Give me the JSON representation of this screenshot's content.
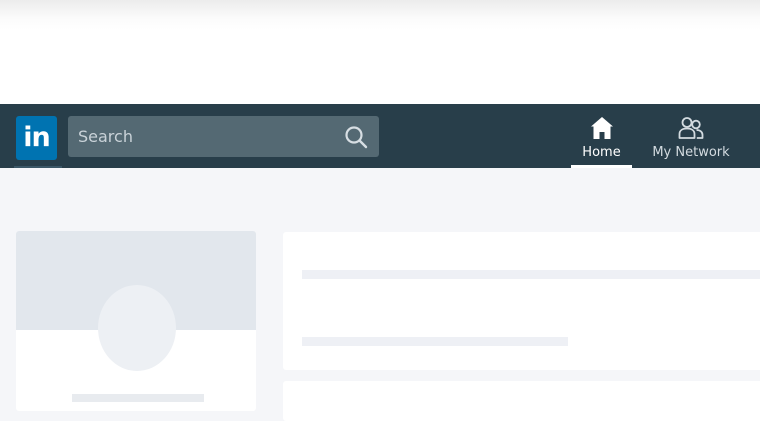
{
  "app": {
    "logo_text": "in"
  },
  "search": {
    "placeholder": "Search",
    "value": ""
  },
  "nav": {
    "items": [
      {
        "label": "Home",
        "icon": "home-icon",
        "active": true
      },
      {
        "label": "My Network",
        "icon": "my-network-icon",
        "active": false
      }
    ]
  },
  "colors": {
    "navbar_bg": "#283e4a",
    "logo_bg": "#0073b1",
    "search_bg": "#546973",
    "page_bg": "#f5f6f9"
  }
}
